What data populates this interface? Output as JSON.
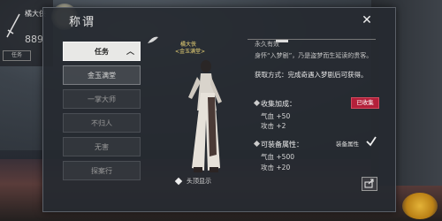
{
  "hud": {
    "name": "橘大侠",
    "number": "889",
    "slot": "任务"
  },
  "panel": {
    "title": "称谓",
    "close_icon": "close-icon"
  },
  "tabs": {
    "category": "任务",
    "items": [
      "金玉满堂",
      "一掌大师",
      "不归人",
      "无害",
      "探案行"
    ],
    "active_index": 0
  },
  "character": {
    "name": "橘大侠",
    "title_badge": "<金玉满堂>",
    "toggle_label": "头顶显示"
  },
  "detail": {
    "duration": "永久有效",
    "description": "身怀“入梦剧”，乃是盗梦而生延读的贵客。",
    "obtain": "获取方式：完成奇遇入梦剧后可获得。",
    "collect": {
      "label": "收集加成：",
      "badge": "已收集",
      "stats": [
        "气血 +50",
        "攻击 +2"
      ]
    },
    "equip": {
      "label": "可装备属性：",
      "equip_label": "装备属性",
      "stats": [
        "气血 +500",
        "攻击 +20"
      ]
    }
  },
  "colors": {
    "badge_red": "#b3203a",
    "accent_gold": "#f0d878",
    "tab_active": "#e8e8e6"
  }
}
